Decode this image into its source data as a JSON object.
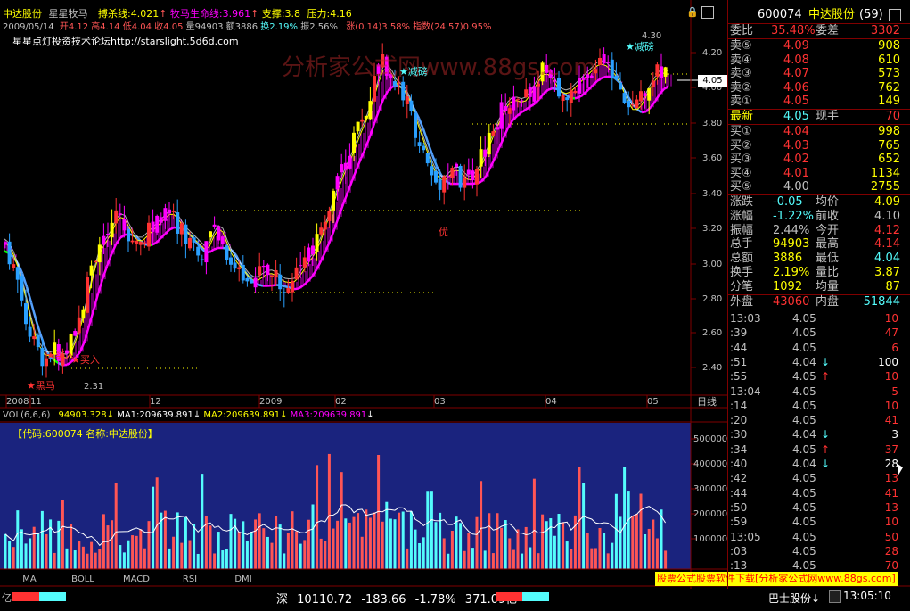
{
  "colors": {
    "up": "#ff3232",
    "down": "#54fcfc",
    "yellow": "#ffff00",
    "magenta": "#ff00ff",
    "white": "#ffffff",
    "green": "#00ff00",
    "blue_bg": "#1a237e",
    "label_red": "#ff5555"
  },
  "header": {
    "stock": "中达股份",
    "indicator": "星星牧马",
    "kill": "搏杀线:4.021",
    "life": "牧马生命线:3.961",
    "support": "支撑:3.8",
    "pressure": "压力:4.16",
    "date": "2009/05/14",
    "open": "开4.12",
    "high": "高4.14",
    "low": "低4.04",
    "close": "收4.05",
    "vol": "量94903",
    "amount": "额3886",
    "turnover": "换2.19%",
    "amp": "振2.56%",
    "change": "涨(0.14)3.58%",
    "index": "指数(24.57)0.95%",
    "forum": "星星点灯投资技术论坛http://starslight.5d6d.com",
    "watermark": "分析家公式网www.88gs.com"
  },
  "price_axis": [
    "4.20",
    "4.00",
    "3.80",
    "3.60",
    "3.40",
    "3.20",
    "3.00",
    "2.80",
    "2.60",
    "2.40"
  ],
  "price_current": "4.05",
  "annotations": {
    "high_label": "4.30",
    "low_label": "2.31",
    "reduce1": "★减磅",
    "reduce2": "★减磅",
    "buy1": "★买入",
    "buy2": "★买入",
    "black": "★黑马",
    "you": "优"
  },
  "date_axis": [
    "2008",
    "11",
    "12",
    "2009",
    "02",
    "03",
    "04",
    "05"
  ],
  "date_axis_right": "日线",
  "vol_header": {
    "vol": "VOL(6,6,6)",
    "v1": "94903.328",
    "ma1": "MA1:209639.891",
    "ma2": "MA2:209639.891",
    "ma3": "MA3:209639.891"
  },
  "vol_code": "【代码:600074 名称:中达股份】",
  "vol_axis": [
    "500000",
    "400000",
    "300000",
    "200000",
    "100000"
  ],
  "vol_unit": "亿",
  "tabs": [
    "MA",
    "BOLL",
    "MACD",
    "RSI",
    "DMI"
  ],
  "status": {
    "market": "深",
    "index": "10110.72",
    "change": "-183.66",
    "pct": "-1.78%",
    "amount": "371.09亿",
    "ad": "股票公式股票软件下载[分析家公式网www.88gs.com]",
    "ticker": "巴士股份↓",
    "time": "13:05:10"
  },
  "quote": {
    "code": "600074",
    "name": "中达股份",
    "count": "(59)",
    "weibi_label": "委比",
    "weibi": "35.48%",
    "weicha_label": "委差",
    "weicha": "3302",
    "sell": [
      {
        "label": "卖⑤",
        "price": "4.09",
        "vol": "908"
      },
      {
        "label": "卖④",
        "price": "4.08",
        "vol": "610"
      },
      {
        "label": "卖③",
        "price": "4.07",
        "vol": "573"
      },
      {
        "label": "卖②",
        "price": "4.06",
        "vol": "762"
      },
      {
        "label": "卖①",
        "price": "4.05",
        "vol": "149"
      }
    ],
    "latest_label": "最新",
    "latest": "4.05",
    "xianshou_label": "现手",
    "xianshou": "70",
    "buy": [
      {
        "label": "买①",
        "price": "4.04",
        "vol": "998"
      },
      {
        "label": "买②",
        "price": "4.03",
        "vol": "765"
      },
      {
        "label": "买③",
        "price": "4.02",
        "vol": "652"
      },
      {
        "label": "买④",
        "price": "4.01",
        "vol": "1134"
      },
      {
        "label": "买⑤",
        "price": "4.00",
        "vol": "2755"
      }
    ],
    "stats": [
      {
        "l1": "涨跌",
        "v1": "-0.05",
        "l2": "均价",
        "v2": "4.09"
      },
      {
        "l1": "涨幅",
        "v1": "-1.22%",
        "l2": "前收",
        "v2": "4.10"
      },
      {
        "l1": "振幅",
        "v1": "2.44%",
        "l2": "今开",
        "v2": "4.12"
      },
      {
        "l1": "总手",
        "v1": "94903",
        "l2": "最高",
        "v2": "4.14"
      },
      {
        "l1": "总额",
        "v1": "3886",
        "l2": "最低",
        "v2": "4.04"
      },
      {
        "l1": "换手",
        "v1": "2.19%",
        "l2": "量比",
        "v2": "3.87"
      },
      {
        "l1": "分笔",
        "v1": "1092",
        "l2": "均量",
        "v2": "87"
      }
    ],
    "outer_label": "外盘",
    "outer": "43060",
    "inner_label": "内盘",
    "inner": "51844"
  },
  "ticks": [
    {
      "t": "13:03",
      "p": "4.05",
      "a": "",
      "v": "10"
    },
    {
      "t": ":39",
      "p": "4.05",
      "a": "",
      "v": "47"
    },
    {
      "t": ":44",
      "p": "4.05",
      "a": "",
      "v": "6"
    },
    {
      "t": ":51",
      "p": "4.04",
      "a": "↓",
      "v": "100"
    },
    {
      "t": ":55",
      "p": "4.05",
      "a": "↑",
      "v": "10"
    },
    {
      "t": "13:04",
      "p": "4.05",
      "a": "",
      "v": "5"
    },
    {
      "t": ":14",
      "p": "4.05",
      "a": "",
      "v": "10"
    },
    {
      "t": ":20",
      "p": "4.05",
      "a": "",
      "v": "41"
    },
    {
      "t": ":30",
      "p": "4.04",
      "a": "↓",
      "v": "3"
    },
    {
      "t": ":34",
      "p": "4.05",
      "a": "↑",
      "v": "37"
    },
    {
      "t": ":40",
      "p": "4.04",
      "a": "↓",
      "v": "28"
    },
    {
      "t": ":42",
      "p": "4.05",
      "a": "",
      "v": "13"
    },
    {
      "t": ":44",
      "p": "4.05",
      "a": "",
      "v": "41"
    },
    {
      "t": ":50",
      "p": "4.05",
      "a": "",
      "v": "13"
    },
    {
      "t": ":59",
      "p": "4.05",
      "a": "",
      "v": "10"
    },
    {
      "t": "13:05",
      "p": "4.05",
      "a": "",
      "v": "50"
    },
    {
      "t": ":03",
      "p": "4.05",
      "a": "",
      "v": "28"
    },
    {
      "t": ":13",
      "p": "4.05",
      "a": "",
      "v": "70"
    }
  ],
  "chart_data": {
    "type": "candlestick",
    "price_range": [
      2.31,
      4.3
    ],
    "points": [
      [
        0,
        3.18
      ],
      [
        10,
        3.05
      ],
      [
        20,
        2.9
      ],
      [
        30,
        2.65
      ],
      [
        40,
        2.5
      ],
      [
        50,
        2.45
      ],
      [
        60,
        2.5
      ],
      [
        70,
        2.42
      ],
      [
        80,
        2.55
      ],
      [
        90,
        2.7
      ],
      [
        100,
        2.95
      ],
      [
        110,
        3.1
      ],
      [
        120,
        3.15
      ],
      [
        130,
        3.3
      ],
      [
        140,
        3.2
      ],
      [
        150,
        3.1
      ],
      [
        160,
        3.15
      ],
      [
        170,
        3.2
      ],
      [
        180,
        3.25
      ],
      [
        190,
        3.3
      ],
      [
        200,
        3.2
      ],
      [
        210,
        3.15
      ],
      [
        220,
        3.1
      ],
      [
        230,
        3.05
      ],
      [
        240,
        3.25
      ],
      [
        250,
        3.1
      ],
      [
        260,
        3.0
      ],
      [
        270,
        2.95
      ],
      [
        280,
        2.88
      ],
      [
        290,
        2.92
      ],
      [
        300,
        2.95
      ],
      [
        310,
        2.9
      ],
      [
        320,
        2.88
      ],
      [
        330,
        2.9
      ],
      [
        340,
        3.0
      ],
      [
        350,
        3.05
      ],
      [
        360,
        3.2
      ],
      [
        370,
        3.35
      ],
      [
        380,
        3.5
      ],
      [
        390,
        3.6
      ],
      [
        400,
        3.75
      ],
      [
        410,
        3.85
      ],
      [
        420,
        4.05
      ],
      [
        430,
        4.15
      ],
      [
        440,
        4.0
      ],
      [
        450,
        4.0
      ],
      [
        460,
        3.85
      ],
      [
        470,
        3.7
      ],
      [
        480,
        3.55
      ],
      [
        490,
        3.45
      ],
      [
        500,
        3.5
      ],
      [
        510,
        3.55
      ],
      [
        520,
        3.45
      ],
      [
        530,
        3.5
      ],
      [
        540,
        3.6
      ],
      [
        550,
        3.75
      ],
      [
        560,
        3.85
      ],
      [
        570,
        3.95
      ],
      [
        580,
        3.9
      ],
      [
        590,
        3.95
      ],
      [
        600,
        4.05
      ],
      [
        610,
        4.1
      ],
      [
        620,
        4.0
      ],
      [
        630,
        3.95
      ],
      [
        640,
        4.0
      ],
      [
        650,
        4.05
      ],
      [
        660,
        4.1
      ],
      [
        670,
        4.15
      ],
      [
        680,
        4.1
      ],
      [
        690,
        4.05
      ],
      [
        700,
        3.9
      ],
      [
        710,
        3.85
      ],
      [
        720,
        3.95
      ],
      [
        730,
        4.05
      ],
      [
        740,
        4.1
      ],
      [
        750,
        4.05
      ]
    ]
  }
}
